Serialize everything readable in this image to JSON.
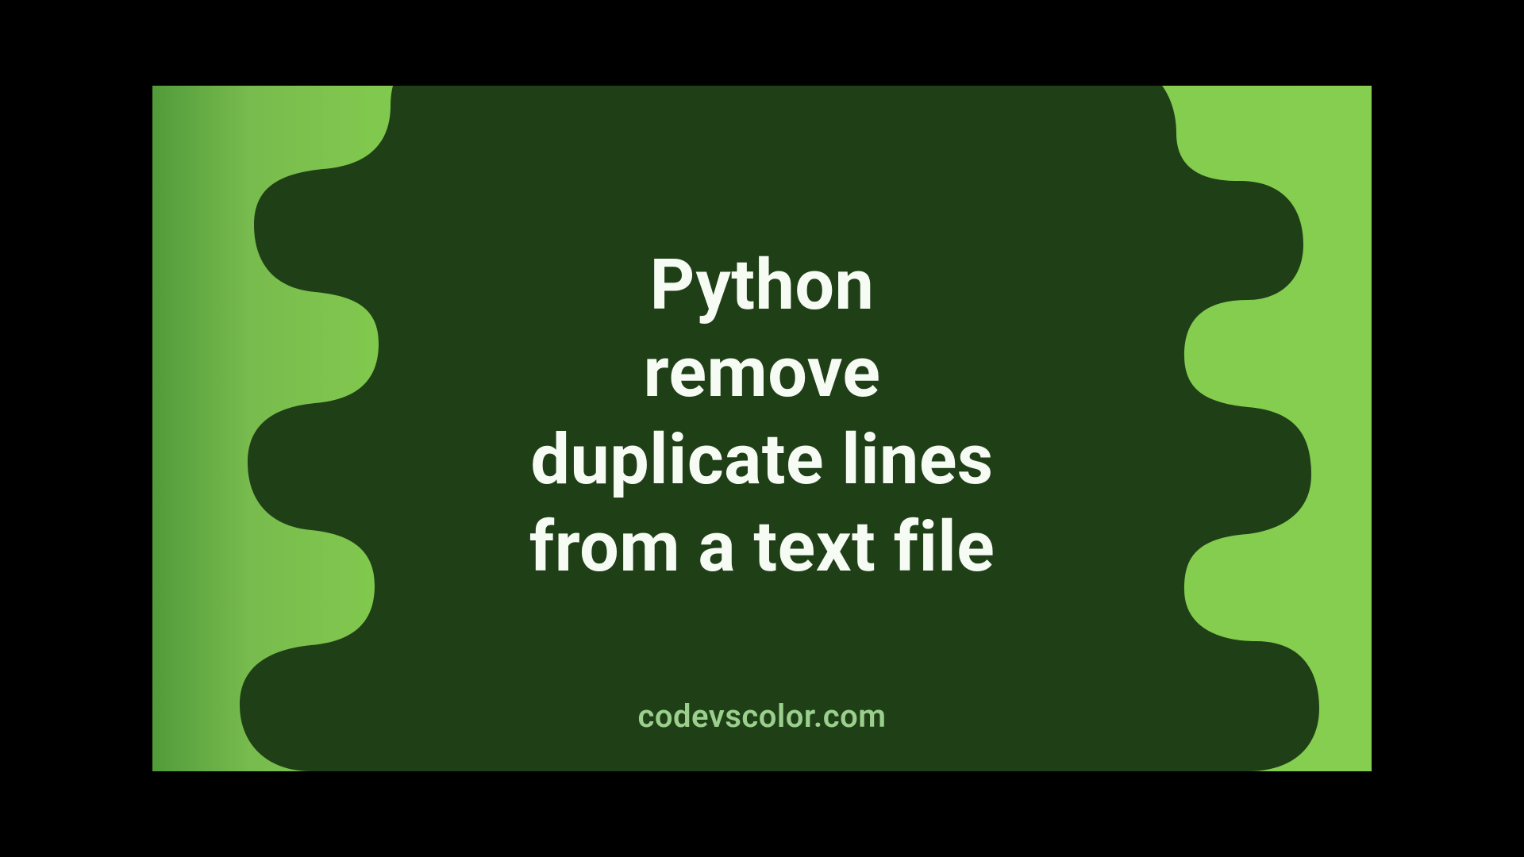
{
  "title_lines": "Python\nremove\nduplicate lines\nfrom a text file",
  "brand": "codevscolor.com",
  "colors": {
    "blob": "#1f3f17",
    "text": "#f6fbf4",
    "brand_text": "#9bcf8d",
    "gradient_from": "#519b3a",
    "gradient_to": "#85ce4f"
  }
}
